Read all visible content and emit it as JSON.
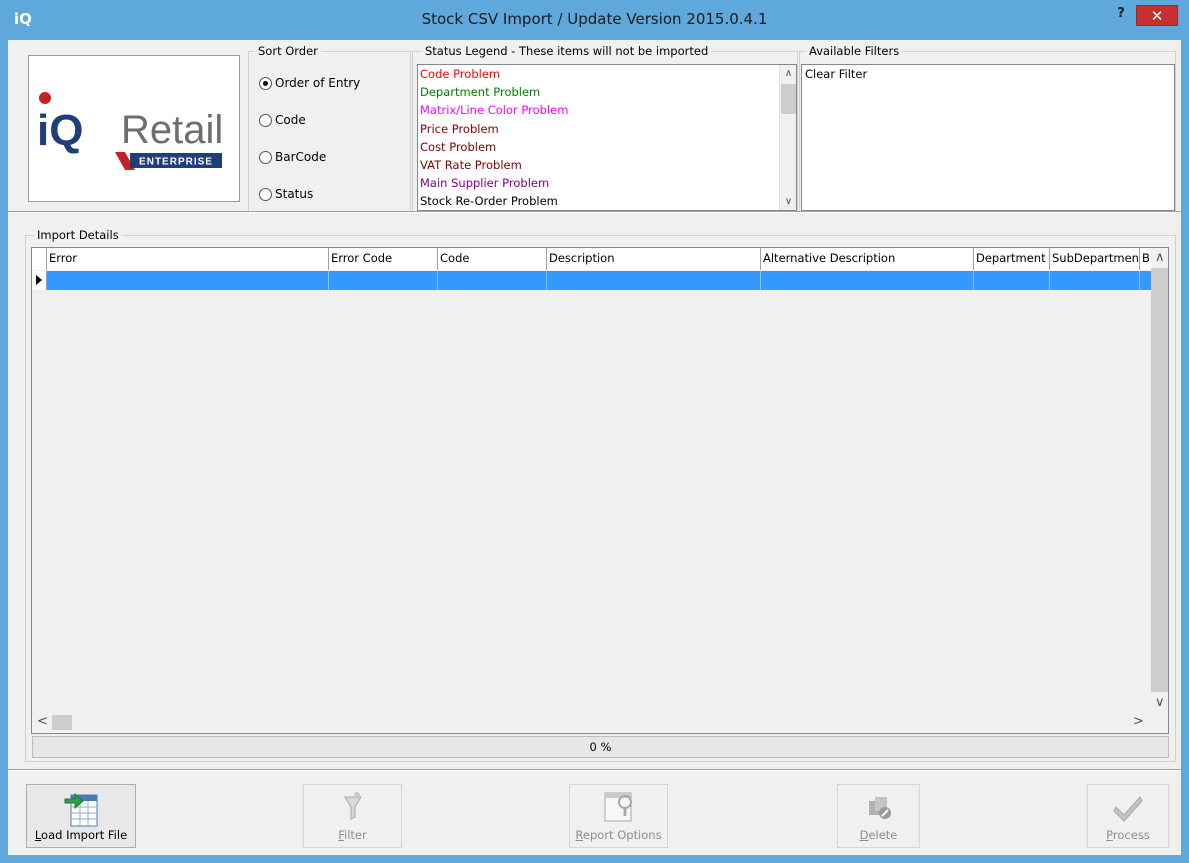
{
  "window": {
    "app_icon_text": "iQ",
    "title": "Stock CSV Import / Update Version 2015.0.4.1",
    "help_label": "?",
    "close_label": "✕"
  },
  "logo": {
    "brand_iq": "iQ",
    "brand_retail": "Retail",
    "tagline": "ENTERPRISE",
    "colors": {
      "blue": "#1f3f7a",
      "red": "#c42128",
      "gray": "#6d6e71"
    }
  },
  "sort_order": {
    "label": "Sort Order",
    "options": [
      {
        "label": "Order of Entry",
        "checked": true
      },
      {
        "label": "Code",
        "checked": false
      },
      {
        "label": "BarCode",
        "checked": false
      },
      {
        "label": "Status",
        "checked": false
      }
    ]
  },
  "status_legend": {
    "label": "Status Legend - These items will not be imported",
    "items": [
      {
        "label": "Code Problem",
        "color": "#ff0000"
      },
      {
        "label": "Department Problem",
        "color": "#008000"
      },
      {
        "label": "Matrix/Line Color Problem",
        "color": "#ff00ff"
      },
      {
        "label": "Price Problem",
        "color": "#800000"
      },
      {
        "label": "Cost Problem",
        "color": "#800000"
      },
      {
        "label": "VAT Rate Problem",
        "color": "#800000"
      },
      {
        "label": "Main Supplier Problem",
        "color": "#800080"
      },
      {
        "label": "Stock Re-Order Problem",
        "color": "#000000"
      }
    ]
  },
  "available_filters": {
    "label": "Available Filters",
    "items": [
      "Clear Filter"
    ]
  },
  "import_details": {
    "label": "Import Details",
    "columns": [
      "Error",
      "Error Code",
      "Code",
      "Description",
      "Alternative Description",
      "Department",
      "SubDepartment",
      "B"
    ],
    "progress_text": "0 %"
  },
  "toolbar": {
    "buttons": [
      {
        "label": "Load Import File",
        "mnemonic": "L",
        "rest": "oad Import File",
        "enabled": true
      },
      {
        "label": "Filter",
        "mnemonic": "F",
        "rest": "ilter",
        "enabled": false
      },
      {
        "label": "Report Options",
        "mnemonic": "R",
        "rest": "eport Options",
        "enabled": false
      },
      {
        "label": "Delete",
        "mnemonic": "D",
        "rest": "elete",
        "enabled": false
      },
      {
        "label": "Process",
        "mnemonic": "P",
        "rest": "rocess",
        "enabled": false
      }
    ]
  }
}
